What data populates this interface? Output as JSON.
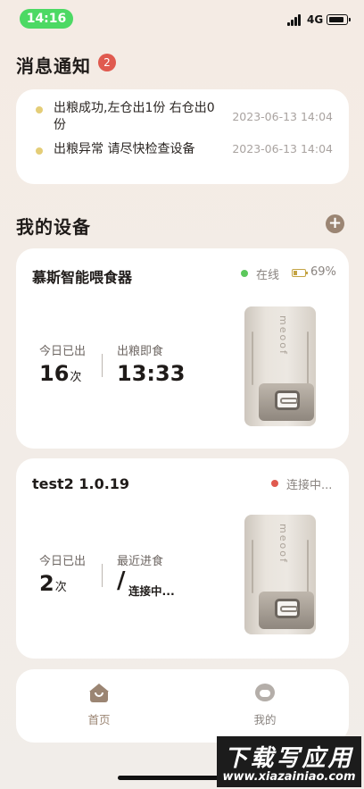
{
  "status_bar": {
    "time": "14:16",
    "network": "4G"
  },
  "messages": {
    "title": "消息通知",
    "badge_count": "2",
    "items": [
      {
        "text": "出粮成功,左仓出1份 右仓出0份",
        "time": "2023-06-13 14:04",
        "dot_color": "#e4cd77"
      },
      {
        "text": "出粮异常 请尽快检查设备",
        "time": "2023-06-13 14:04",
        "dot_color": "#e4cd77"
      }
    ]
  },
  "devices": {
    "title": "我的设备",
    "add_icon": "plus-circle-icon",
    "cards": [
      {
        "name": "慕斯智能喂食器",
        "status": "在线",
        "status_color": "#5cc85c",
        "battery": "69%",
        "stat1_label": "今日已出",
        "stat1_value": "16",
        "stat1_unit": "次",
        "stat2_label": "出粮即食",
        "stat2_value": "13:33",
        "logo": "meoof"
      },
      {
        "name": "test2 1.0.19",
        "status": "连接中...",
        "status_color": "#e05a4f",
        "stat1_label": "今日已出",
        "stat1_value": "2",
        "stat1_unit": "次",
        "stat2_label": "最近进食",
        "stat2_value": "/",
        "stat2_sub": "连接中...",
        "logo": "meoof"
      }
    ]
  },
  "nav": {
    "home": {
      "label": "首页",
      "icon": "home-icon",
      "color": "#9b8573"
    },
    "mine": {
      "label": "我的",
      "icon": "profile-icon",
      "color": "#8a8480"
    }
  },
  "watermark": {
    "title": "下载写应用",
    "url": "www.xiazainiao.com"
  }
}
